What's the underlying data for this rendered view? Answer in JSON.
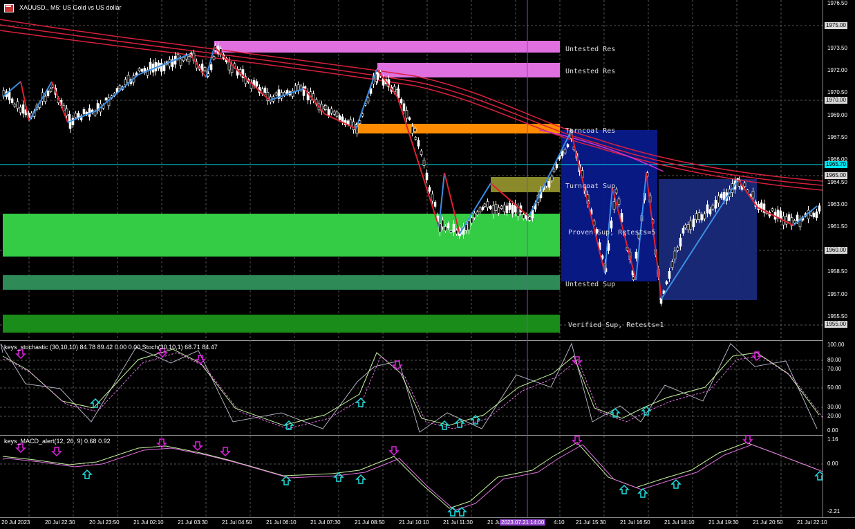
{
  "window": {
    "title": "XAUUSD., M5:  US Gold vs US dollar"
  },
  "colors": {
    "background": "#000000",
    "bull_candle": "#ffffff",
    "bear_candle": "#ffffff",
    "zigzag_up": "#3a8ee6",
    "zigzag_down": "#e0202e",
    "ma_lines": "#d8203c",
    "ma_magenta": "#d030d0",
    "cursor_line": "#8e44c8",
    "hline_cyan": "#00e5ee"
  },
  "zones": [
    {
      "label": "Untested Res",
      "color": "#e070e0"
    },
    {
      "label": "Untested Res",
      "color": "#e070e0"
    },
    {
      "label": "Turncoat Res",
      "color": "#ff8c00"
    },
    {
      "label": "Turncoat Sup",
      "color": "#8a8a2a"
    },
    {
      "label": "Proven Sup, Retests=5",
      "color": "#33cc44"
    },
    {
      "label": "Untested Sup",
      "color": "#2e8b57"
    },
    {
      "label": "Verified Sup, Retests=1",
      "color": "#1a8c1a"
    }
  ],
  "price_axis": {
    "labels": [
      "1976.50",
      "1975.00",
      "1973.50",
      "1972.00",
      "1970.50",
      "1970.00",
      "1969.00",
      "1967.50",
      "1966.00",
      "1965.70",
      "1965.00",
      "1964.50",
      "1963.00",
      "1961.50",
      "1960.00",
      "1958.50",
      "1957.00",
      "1955.50",
      "1955.00"
    ],
    "current_price": "1965.70"
  },
  "stochastic": {
    "title": "keys_stochastic (30,10,10) 84.78 89.42 0.00 0.00 Stoch(30,10,1) 68.71 84.47",
    "levels": [
      "100.00",
      "80.00",
      "70.00",
      "50.00",
      "30.00",
      "20.00",
      "0.00"
    ]
  },
  "macd": {
    "title": "keys_MACD_alert(12, 26, 9) 0.68 0.92",
    "levels": [
      "1.16",
      "0.00",
      "-2.21"
    ]
  },
  "time_axis": {
    "labels": [
      "20 Jul 2023",
      "20 Jul 22:30",
      "20 Jul 23:50",
      "21 Jul 02:10",
      "21 Jul 03:30",
      "21 Jul 04:50",
      "21 Jul 06:10",
      "21 Jul 07:30",
      "21 Jul 08:50",
      "21 Jul 10:10",
      "21 Jul 11:30",
      "21 Jul",
      "2023.07.21 14:00",
      "4:10",
      "21 Jul 15:30",
      "21 Jul 16:50",
      "21 Jul 18:10",
      "21 Jul 19:30",
      "21 Jul 20:50",
      "21 Jul 22:10"
    ],
    "cursor_label": "2023.07.21 14:00"
  }
}
